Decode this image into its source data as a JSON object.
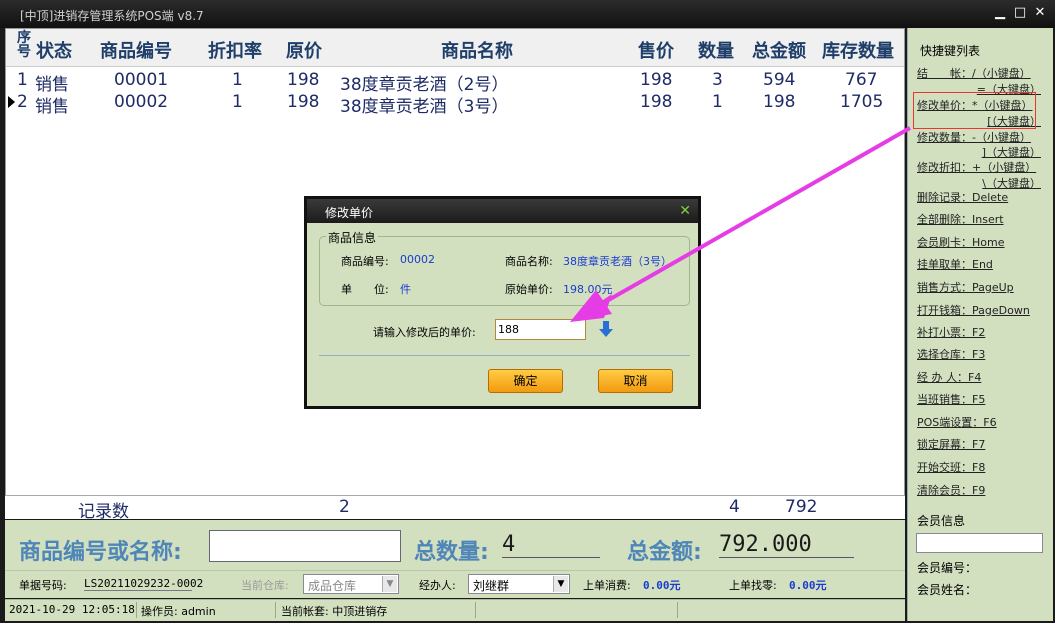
{
  "window": {
    "title": "[中顶]进销存管理系统POS端 v8.7",
    "minimize_glyph": "▁",
    "maximize_glyph": "□",
    "close_glyph": "✕"
  },
  "table": {
    "headers": {
      "seq": "序号",
      "status": "状态",
      "code": "商品编号",
      "discount": "折扣率",
      "orig_price": "原价",
      "name": "商品名称",
      "price": "售价",
      "qty": "数量",
      "total": "总金额",
      "stock": "库存数量"
    },
    "rows": [
      {
        "seq": "1",
        "status": "销售",
        "code": "00001",
        "discount": "1",
        "orig_price": "198",
        "name": "38度章贡老酒（2号）",
        "price": "198",
        "qty": "3",
        "total": "594",
        "stock": "767"
      },
      {
        "seq": "2",
        "status": "销售",
        "code": "00002",
        "discount": "1",
        "orig_price": "198",
        "name": "38度章贡老酒（3号）",
        "price": "198",
        "qty": "1",
        "total": "198",
        "stock": "1705"
      }
    ],
    "footer": {
      "label": "记录数",
      "count": "2",
      "qty": "4",
      "total": "792"
    }
  },
  "shortcuts": {
    "title": "快捷键列表",
    "items": [
      {
        "label": "结　　帐：/（小键盘）",
        "alt": "=（大键盘）"
      },
      {
        "label": "修改单价：*（小键盘）",
        "alt": "[（大键盘）"
      },
      {
        "label": "修改数量：-（小键盘）",
        "alt": "]（大键盘）"
      },
      {
        "label": "修改折扣：+（小键盘）",
        "alt": "\\（大键盘）"
      },
      {
        "label": "删除记录：Delete"
      },
      {
        "label": "全部删除：Insert"
      },
      {
        "label": "会员刷卡：Home"
      },
      {
        "label": "挂单取单：End"
      },
      {
        "label": "销售方式：PageUp"
      },
      {
        "label": "打开钱箱：PageDown"
      },
      {
        "label": "补打小票：F2"
      },
      {
        "label": "选择仓库：F3"
      },
      {
        "label": "经 办 人：F4"
      },
      {
        "label": "当班销售：F5"
      },
      {
        "label": "POS端设置：F6"
      },
      {
        "label": "锁定屏幕：F7"
      },
      {
        "label": "开始交班：F8"
      },
      {
        "label": "清除会员：F9"
      }
    ]
  },
  "member": {
    "title": "会员信息",
    "number_label": "会员编号：",
    "name_label": "会员姓名："
  },
  "entry": {
    "code_label": "商品编号或名称:",
    "code_value": "",
    "qty_label": "总数量:",
    "qty_value": "4",
    "amount_label": "总金额:",
    "amount_value": "792.000"
  },
  "info": {
    "doc_label": "单据号码:",
    "doc_value": "LS20211029232-0002",
    "warehouse_label": "当前仓库:",
    "warehouse_value": "成品仓库",
    "handler_label": "经办人:",
    "handler_value": "刘继群",
    "last_spend_label": "上单消费:",
    "last_spend_value": "0.00元",
    "last_change_label": "上单找零:",
    "last_change_value": "0.00元"
  },
  "status_bar": {
    "datetime": "2021-10-29 12:05:18",
    "operator": "操作员: admin",
    "account": "当前帐套: 中顶进销存"
  },
  "dialog": {
    "title": "修改单价",
    "close_glyph": "✕",
    "group_title": "商品信息",
    "code_label": "商品编号:",
    "code_value": "00002",
    "name_label": "商品名称:",
    "name_value": "38度章贡老酒（3号）",
    "unit_label": "单　　位:",
    "unit_value": "件",
    "orig_label": "原始单价:",
    "orig_value": "198.00元",
    "prompt": "请输入修改后的单价:",
    "input_value": "188",
    "ok": "确定",
    "cancel": "取消"
  },
  "colors": {
    "panel": "#d3e0c0",
    "header_text": "#1f3f6a",
    "row_text": "#1e2b66",
    "highlight_arrow": "#e63ce6",
    "button": "#f5a623"
  }
}
